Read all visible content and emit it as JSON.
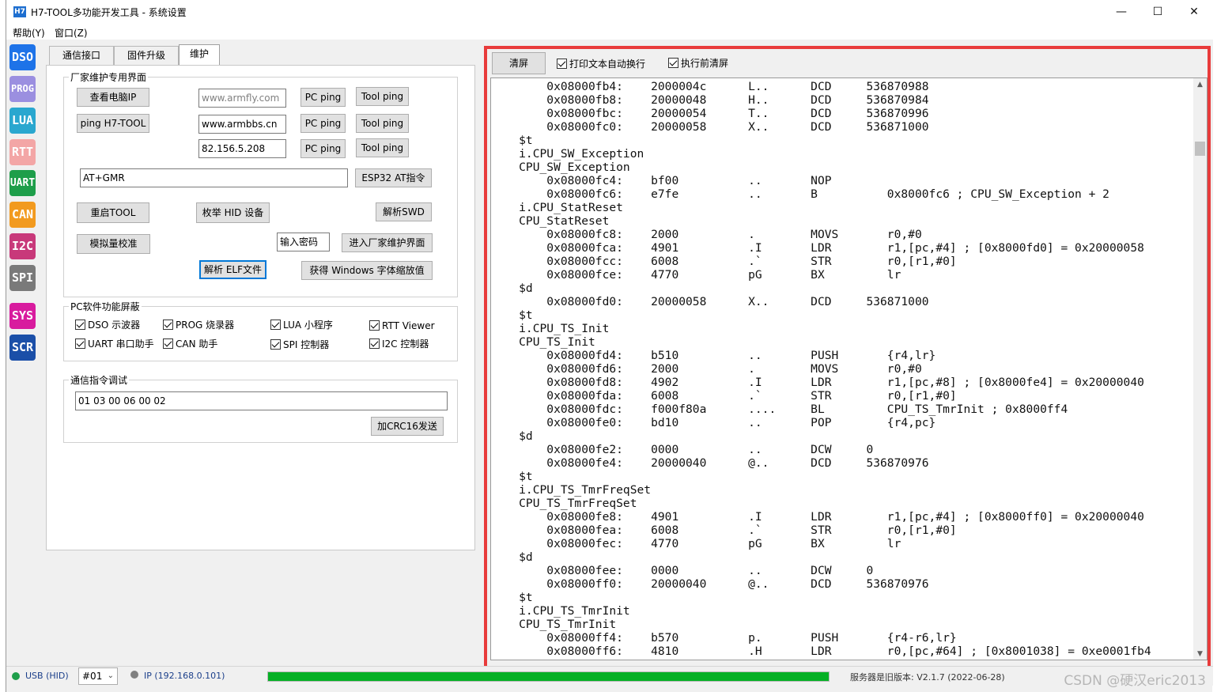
{
  "window": {
    "icon_text": "H7",
    "title": "H7-TOOL多功能开发工具 - 系统设置",
    "controls": {
      "minimize": "—",
      "maximize": "☐",
      "close": "✕"
    }
  },
  "menu": [
    "帮助(Y)",
    "窗口(Z)"
  ],
  "sidebar": [
    {
      "label": "DSO",
      "color": "#1e73e8"
    },
    {
      "label": "PROG",
      "color": "#9b8fe0"
    },
    {
      "label": "LUA",
      "color": "#2aa7cf"
    },
    {
      "label": "RTT",
      "color": "#f3a6a6"
    },
    {
      "label": "UART",
      "color": "#1e9e4a"
    },
    {
      "label": "CAN",
      "color": "#f29a1f"
    },
    {
      "label": "I2C",
      "color": "#c8397a"
    },
    {
      "label": "SPI",
      "color": "#7a7a7a"
    },
    {
      "label": "SYS",
      "color": "#d81b9e"
    },
    {
      "label": "SCR",
      "color": "#1b4fa8"
    }
  ],
  "tabs": [
    "通信接口",
    "固件升级",
    "维护"
  ],
  "factory": {
    "title": "厂家维护专用界面",
    "view_ip": "查看电脑IP",
    "host1_placeholder": "www.armfly.com",
    "pc_ping": "PC ping",
    "tool_ping": "Tool ping",
    "ping_h7": "ping H7-TOOL",
    "host2": "www.armbbs.cn",
    "host3": "82.156.5.208",
    "at_cmd": "AT+GMR",
    "esp32": "ESP32 AT指令",
    "restart": "重启TOOL",
    "enum_hid": "枚举 HID 设备",
    "parse_swd": "解析SWD",
    "analog_cal": "模拟量校准",
    "password": "输入密码",
    "enter_factory": "进入厂家维护界面",
    "parse_elf": "解析 ELF文件",
    "win_scale": "获得 Windows 字体缩放值"
  },
  "features": {
    "title": "PC软件功能屏蔽",
    "items": [
      "DSO 示波器",
      "PROG 烧录器",
      "LUA 小程序",
      "RTT Viewer",
      "UART 串口助手",
      "CAN 助手",
      "SPI 控制器",
      "I2C 控制器"
    ]
  },
  "debug": {
    "title": "通信指令调试",
    "value": "01 03 00 06 00 02",
    "send": "加CRC16发送"
  },
  "console": {
    "clear": "清屏",
    "auto_wrap": "打印文本自动换行",
    "clear_before": "执行前清屏",
    "lines": [
      "        0x08000fb4:    2000004c      L..      DCD     536870988",
      "        0x08000fb8:    20000048      H..      DCD     536870984",
      "        0x08000fbc:    20000054      T..      DCD     536870996",
      "        0x08000fc0:    20000058      X..      DCD     536871000",
      "    $t",
      "    i.CPU_SW_Exception",
      "    CPU_SW_Exception",
      "        0x08000fc4:    bf00          ..       NOP",
      "        0x08000fc6:    e7fe          ..       B          0x8000fc6 ; CPU_SW_Exception + 2",
      "    i.CPU_StatReset",
      "    CPU_StatReset",
      "        0x08000fc8:    2000          .        MOVS       r0,#0",
      "        0x08000fca:    4901          .I       LDR        r1,[pc,#4] ; [0x8000fd0] = 0x20000058",
      "        0x08000fcc:    6008          .`       STR        r0,[r1,#0]",
      "        0x08000fce:    4770          pG       BX         lr",
      "    $d",
      "        0x08000fd0:    20000058      X..      DCD     536871000",
      "    $t",
      "    i.CPU_TS_Init",
      "    CPU_TS_Init",
      "        0x08000fd4:    b510          ..       PUSH       {r4,lr}",
      "        0x08000fd6:    2000          .        MOVS       r0,#0",
      "        0x08000fd8:    4902          .I       LDR        r1,[pc,#8] ; [0x8000fe4] = 0x20000040",
      "        0x08000fda:    6008          .`       STR        r0,[r1,#0]",
      "        0x08000fdc:    f000f80a      ....     BL         CPU_TS_TmrInit ; 0x8000ff4",
      "        0x08000fe0:    bd10          ..       POP        {r4,pc}",
      "    $d",
      "        0x08000fe2:    0000          ..       DCW     0",
      "        0x08000fe4:    20000040      @..      DCD     536870976",
      "    $t",
      "    i.CPU_TS_TmrFreqSet",
      "    CPU_TS_TmrFreqSet",
      "        0x08000fe8:    4901          .I       LDR        r1,[pc,#4] ; [0x8000ff0] = 0x20000040",
      "        0x08000fea:    6008          .`       STR        r0,[r1,#0]",
      "        0x08000fec:    4770          pG       BX         lr",
      "    $d",
      "        0x08000fee:    0000          ..       DCW     0",
      "        0x08000ff0:    20000040      @..      DCD     536870976",
      "    $t",
      "    i.CPU_TS_TmrInit",
      "    CPU_TS_TmrInit",
      "        0x08000ff4:    b570          p.       PUSH       {r4-r6,lr}",
      "        0x08000ff6:    4810          .H       LDR        r0,[pc,#64] ; [0x8001038] = 0xe0001fb4"
    ]
  },
  "status": {
    "usb": "USB (HID)",
    "device": "#01",
    "ip": "IP (192.168.0.101)",
    "progress": 1.0,
    "server": "服务器是旧版本: V2.1.7 (2022-06-28)",
    "watermark": "CSDN @硬汉eric2013"
  },
  "colors": {
    "accent": "#0078d7",
    "highlight_frame": "#e83b3b",
    "progress": "#06b025",
    "status_ok": "#1e9e4a"
  }
}
